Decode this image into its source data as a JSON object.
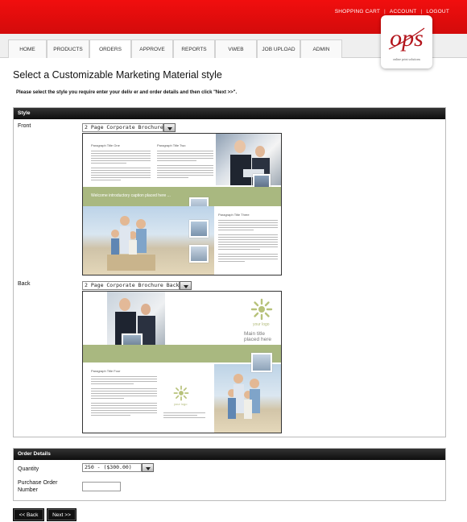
{
  "header": {
    "links": [
      "SHOPPING CART",
      "ACCOUNT",
      "LOGOUT"
    ],
    "background": "#e60e0e"
  },
  "nav": {
    "tabs": [
      "HOME",
      "PRODUCTS",
      "ORDERS",
      "APPROVE",
      "REPORTS",
      "VWEB",
      "JOB UPLOAD",
      "ADMIN"
    ],
    "active": "ORDERS"
  },
  "logo": {
    "mark": "ops",
    "tagline": "online print solutions"
  },
  "page": {
    "title": "Select a Customizable Marketing Material style",
    "instruction": "Please select the style you require enter your deliv er and order details and then click \"Next >>\"."
  },
  "style_panel": {
    "heading": "Style",
    "front_label": "Front",
    "front_select": "2 Page Corporate Brochure",
    "back_label": "Back",
    "back_select": "2 Page Corporate Brochure Back",
    "front_preview": {
      "para1": "Paragraph Title One",
      "para2": "Paragraph Title Two",
      "para3": "Paragraph Title Three",
      "caption": "Welcome introductory caption placed here ..."
    },
    "back_preview": {
      "logo_text": "your logo",
      "main_title": "Main title placed here",
      "para4": "Paragraph Title Four",
      "small_logo_text": "your logo"
    }
  },
  "order_panel": {
    "heading": "Order Details",
    "quantity_label": "Quantity",
    "quantity_value": "250 - ($300.00)",
    "po_label_line1": "Purchase Order",
    "po_label_line2": "Number",
    "po_value": ""
  },
  "buttons": {
    "back": "<< Back",
    "next": "Next >>"
  },
  "colors": {
    "accent_red": "#e60e0e",
    "panel_header": "#111111",
    "brochure_green": "#a9b880"
  }
}
